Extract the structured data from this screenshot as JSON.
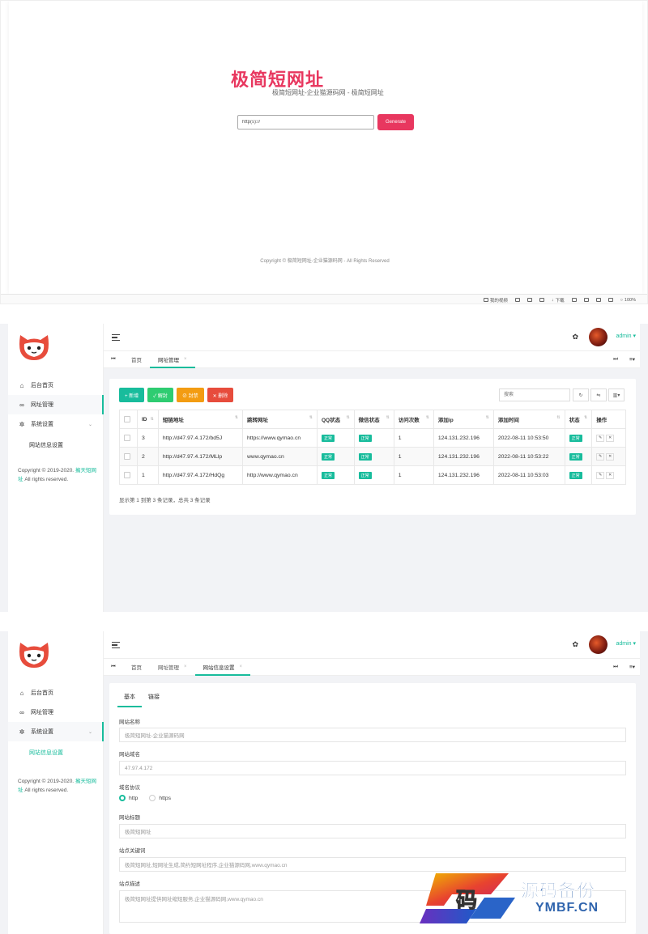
{
  "frontend": {
    "brand_title": "极简短网址",
    "subtitle": "极简短网址-企业猫源码网 - 极简短网址",
    "url_placeholder": "http(s)://",
    "generate_label": "Generate",
    "copyright": "Copyright © 极简短网址-企业猫源码网 - All Rights Reserved",
    "statusbar": [
      "我的视频",
      "下载",
      "100%"
    ]
  },
  "admin": {
    "user": "admin",
    "menu": {
      "home": "后台首页",
      "urls": "网址管理",
      "settings": "系统设置",
      "site_settings": "网站信息设置"
    },
    "copyright_prefix": "Copyright © 2019-2020.",
    "copyright_link": "擁天短网址",
    "copyright_suffix": "All rights reserved."
  },
  "list_page": {
    "tabs": [
      "首页",
      "网址管理"
    ],
    "buttons": {
      "add": "+ 新增",
      "unblock": "✓ 解封",
      "block": "⊘ 封禁",
      "delete": "✕ 删除"
    },
    "search_placeholder": "搜索",
    "columns": [
      "ID",
      "短链地址",
      "跳转网址",
      "QQ状态",
      "微信状态",
      "访问次数",
      "添加ip",
      "添加时间",
      "状态",
      "操作"
    ],
    "rows": [
      {
        "id": "3",
        "short": "http://d47.97.4.172/bd5J",
        "target": "https://www.qymao.cn",
        "qq": "正常",
        "wx": "正常",
        "visits": "1",
        "ip": "124.131.232.196",
        "time": "2022-08-11 10:53:50",
        "status": "正常"
      },
      {
        "id": "2",
        "short": "http://d47.97.4.172/MLlp",
        "target": "www.qymao.cn",
        "qq": "正常",
        "wx": "正常",
        "visits": "1",
        "ip": "124.131.232.196",
        "time": "2022-08-11 10:53:22",
        "status": "正常"
      },
      {
        "id": "1",
        "short": "http://d47.97.4.172/HdQg",
        "target": "http://www.qymao.cn",
        "qq": "正常",
        "wx": "正常",
        "visits": "1",
        "ip": "124.131.232.196",
        "time": "2022-08-11 10:53:03",
        "status": "正常"
      }
    ],
    "pagination": "显示第 1 到第 3 条记录，总共 3 条记录"
  },
  "settings_page": {
    "tabs": [
      "首页",
      "网址管理",
      "网站信息设置"
    ],
    "form_tabs": [
      "基本",
      "链接"
    ],
    "fields": {
      "site_name_label": "网站名称",
      "site_name": "极简短网址-企业猫源码网",
      "domain_label": "网站域名",
      "domain": "47.97.4.172",
      "protocol_label": "域名协议",
      "protocol_options": [
        "http",
        "https"
      ],
      "title_label": "网站标题",
      "title": "极简短网址",
      "keywords_label": "站点关键词",
      "keywords": "极简短网址,短网址生成,简约短网址程序,企业猫源码网,www.qymao.cn",
      "desc_label": "站点描述",
      "desc": "极简短网址提供网址缩短服务,企业猫源码网,www.qymao.cn"
    }
  },
  "watermark": {
    "cn": "源码备份",
    "en": "YMBF.CN",
    "glyph": "码"
  },
  "colors": {
    "accent": "#18bc9c",
    "brand": "#e8375f",
    "watermark": "#2f64ad"
  }
}
